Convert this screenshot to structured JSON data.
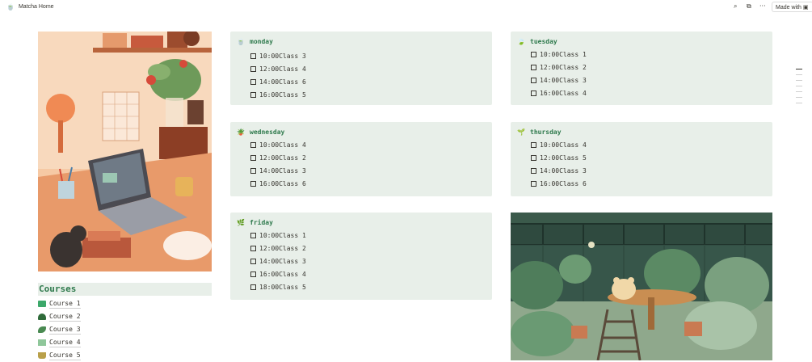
{
  "topbar": {
    "page_title": "Matcha Home",
    "made_with_label": "Made with",
    "icons": [
      "matcha-icon",
      "search-icon",
      "duplicate-icon",
      "more-icon",
      "notion-icon"
    ]
  },
  "courses": {
    "title": "Courses",
    "items": [
      {
        "label": "Course 1",
        "icon": "green-book-icon",
        "color": "#3ca86a"
      },
      {
        "label": "Course 2",
        "icon": "matcha-bowl-icon",
        "color": "#2f6b3a"
      },
      {
        "label": "Course 3",
        "icon": "dango-leaf-icon",
        "color": "#4a8a52"
      },
      {
        "label": "Course 4",
        "icon": "green-tray-icon",
        "color": "#8fc79a"
      },
      {
        "label": "Course 5",
        "icon": "potted-plant-icon",
        "color": "#b9a04a"
      }
    ]
  },
  "days": {
    "monday": {
      "title": "monday",
      "icon": "matcha-bowl-icon",
      "items": [
        {
          "time": "10:00",
          "label": "Class 3"
        },
        {
          "time": "12:00",
          "label": "Class 4"
        },
        {
          "time": "14:00",
          "label": "Class 6"
        },
        {
          "time": "16:00",
          "label": "Class 5"
        }
      ]
    },
    "tuesday": {
      "title": "tuesday",
      "icon": "leaf-icon",
      "items": [
        {
          "time": "10:00",
          "label": "Class 1"
        },
        {
          "time": "12:00",
          "label": "Class 2"
        },
        {
          "time": "14:00",
          "label": "Class 3"
        },
        {
          "time": "16:00",
          "label": "Class 4"
        }
      ]
    },
    "wednesday": {
      "title": "wednesday",
      "icon": "potted-plant-icon",
      "items": [
        {
          "time": "10:00",
          "label": "Class 4"
        },
        {
          "time": "12:00",
          "label": "Class 2"
        },
        {
          "time": "14:00",
          "label": "Class 3"
        },
        {
          "time": "16:00",
          "label": "Class 6"
        }
      ]
    },
    "thursday": {
      "title": "thursday",
      "icon": "sprout-icon",
      "items": [
        {
          "time": "10:00",
          "label": "Class 4"
        },
        {
          "time": "12:00",
          "label": "Class 5"
        },
        {
          "time": "14:00",
          "label": "Class 3"
        },
        {
          "time": "16:00",
          "label": "Class 6"
        }
      ]
    },
    "friday": {
      "title": "friday",
      "icon": "herb-icon",
      "items": [
        {
          "time": "10:00",
          "label": "Class 1"
        },
        {
          "time": "12:00",
          "label": "Class 2"
        },
        {
          "time": "14:00",
          "label": "Class 3"
        },
        {
          "time": "16:00",
          "label": "Class 4"
        },
        {
          "time": "18:00",
          "label": "Class 5"
        }
      ]
    }
  },
  "colors": {
    "card_bg": "#e8efe9",
    "heading_green": "#2f7a4d",
    "text": "#37352f"
  }
}
